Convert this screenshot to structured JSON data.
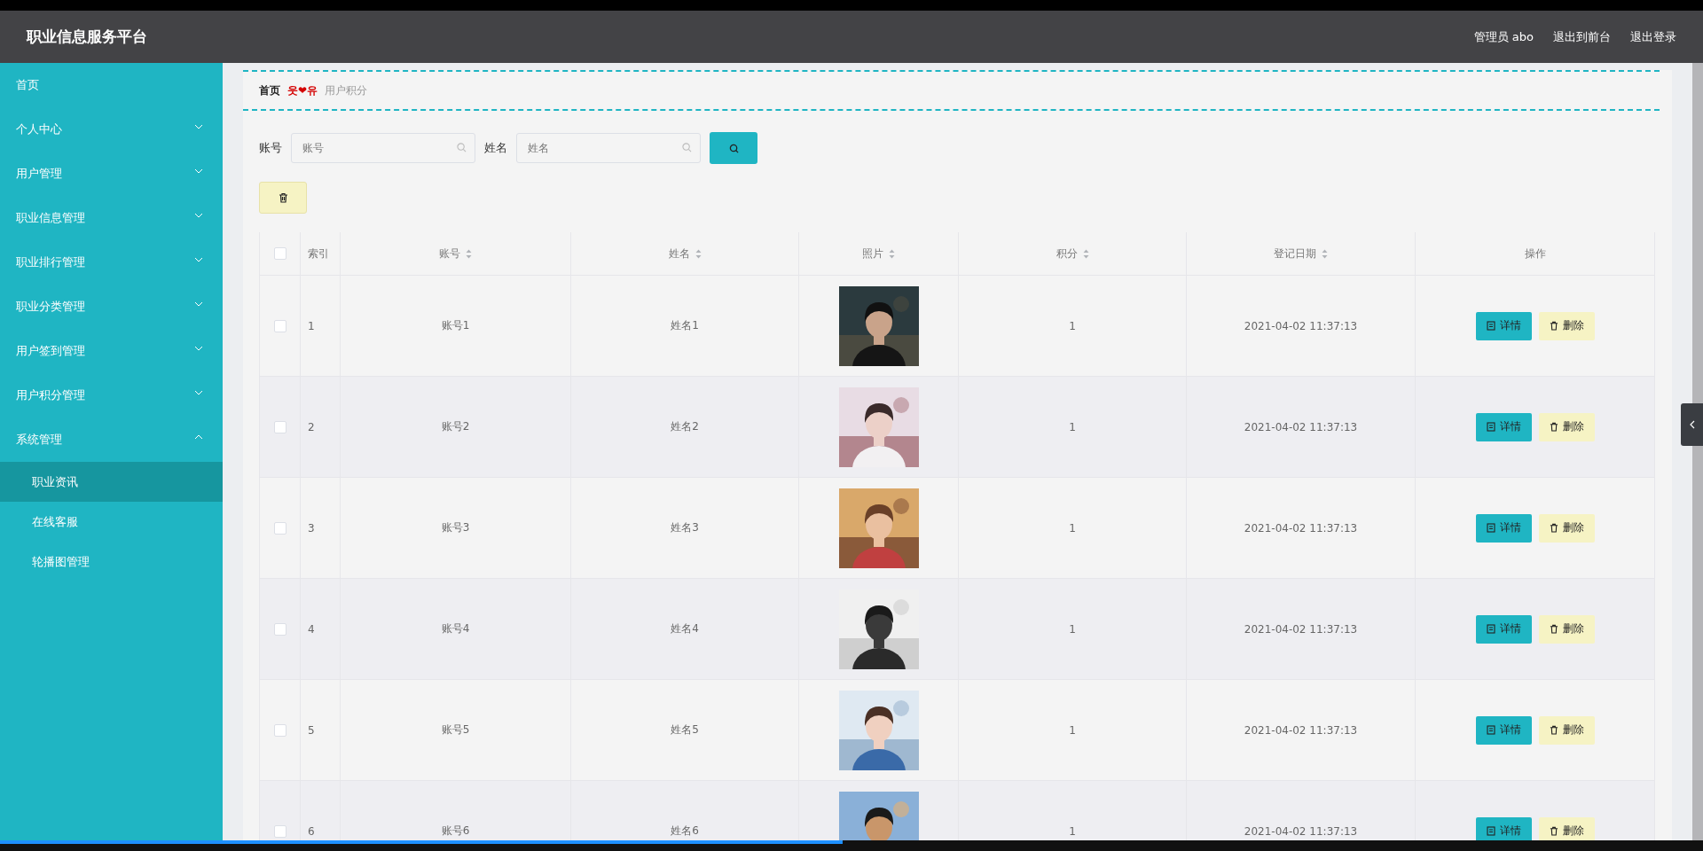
{
  "header": {
    "title": "职业信息服务平台",
    "links": [
      "管理员 abo",
      "退出到前台",
      "退出登录"
    ]
  },
  "sidebar": {
    "items": [
      {
        "label": "首页",
        "kind": "link"
      },
      {
        "label": "个人中心",
        "kind": "menu",
        "expanded": false
      },
      {
        "label": "用户管理",
        "kind": "menu",
        "expanded": false
      },
      {
        "label": "职业信息管理",
        "kind": "menu",
        "expanded": false
      },
      {
        "label": "职业排行管理",
        "kind": "menu",
        "expanded": false
      },
      {
        "label": "职业分类管理",
        "kind": "menu",
        "expanded": false
      },
      {
        "label": "用户签到管理",
        "kind": "menu",
        "expanded": false
      },
      {
        "label": "用户积分管理",
        "kind": "menu",
        "expanded": false
      },
      {
        "label": "系统管理",
        "kind": "menu",
        "expanded": true,
        "children": [
          {
            "label": "职业资讯",
            "selected": true
          },
          {
            "label": "在线客服",
            "selected": false
          },
          {
            "label": "轮播图管理",
            "selected": false
          }
        ]
      }
    ]
  },
  "breadcrumb": {
    "home": "首页",
    "separator": "웃❤유",
    "current": "用户积分"
  },
  "search": {
    "fields": [
      {
        "label": "账号",
        "placeholder": "账号"
      },
      {
        "label": "姓名",
        "placeholder": "姓名"
      }
    ]
  },
  "table": {
    "all_checked": false,
    "columns": [
      {
        "label": "索引",
        "sortable": false
      },
      {
        "label": "账号",
        "sortable": true
      },
      {
        "label": "姓名",
        "sortable": true
      },
      {
        "label": "照片",
        "sortable": true
      },
      {
        "label": "积分",
        "sortable": true
      },
      {
        "label": "登记日期",
        "sortable": true
      },
      {
        "label": "操作",
        "sortable": false
      }
    ],
    "rows": [
      {
        "checked": false,
        "index": "1",
        "account": "账号1",
        "name": "姓名1",
        "photo": {
          "kind": "picture"
        },
        "points": "1",
        "date": "2021-04-02 11:37:13",
        "actions": [
          "详情",
          "删除"
        ]
      },
      {
        "checked": false,
        "index": "2",
        "account": "账号2",
        "name": "姓名2",
        "photo": {
          "kind": "picture"
        },
        "points": "1",
        "date": "2021-04-02 11:37:13",
        "actions": [
          "详情",
          "删除"
        ]
      },
      {
        "checked": false,
        "index": "3",
        "account": "账号3",
        "name": "姓名3",
        "photo": {
          "kind": "picture"
        },
        "points": "1",
        "date": "2021-04-02 11:37:13",
        "actions": [
          "详情",
          "删除"
        ]
      },
      {
        "checked": false,
        "index": "4",
        "account": "账号4",
        "name": "姓名4",
        "photo": {
          "kind": "picture"
        },
        "points": "1",
        "date": "2021-04-02 11:37:13",
        "actions": [
          "详情",
          "删除"
        ]
      },
      {
        "checked": false,
        "index": "5",
        "account": "账号5",
        "name": "姓名5",
        "photo": {
          "kind": "picture"
        },
        "points": "1",
        "date": "2021-04-02 11:37:13",
        "actions": [
          "详情",
          "删除"
        ]
      },
      {
        "checked": false,
        "index": "6",
        "account": "账号6",
        "name": "姓名6",
        "photo": {
          "kind": "picture"
        },
        "points": "1",
        "date": "2021-04-02 11:37:13",
        "actions": [
          "详情",
          "删除"
        ]
      }
    ]
  },
  "player": {
    "level": 0.495
  }
}
